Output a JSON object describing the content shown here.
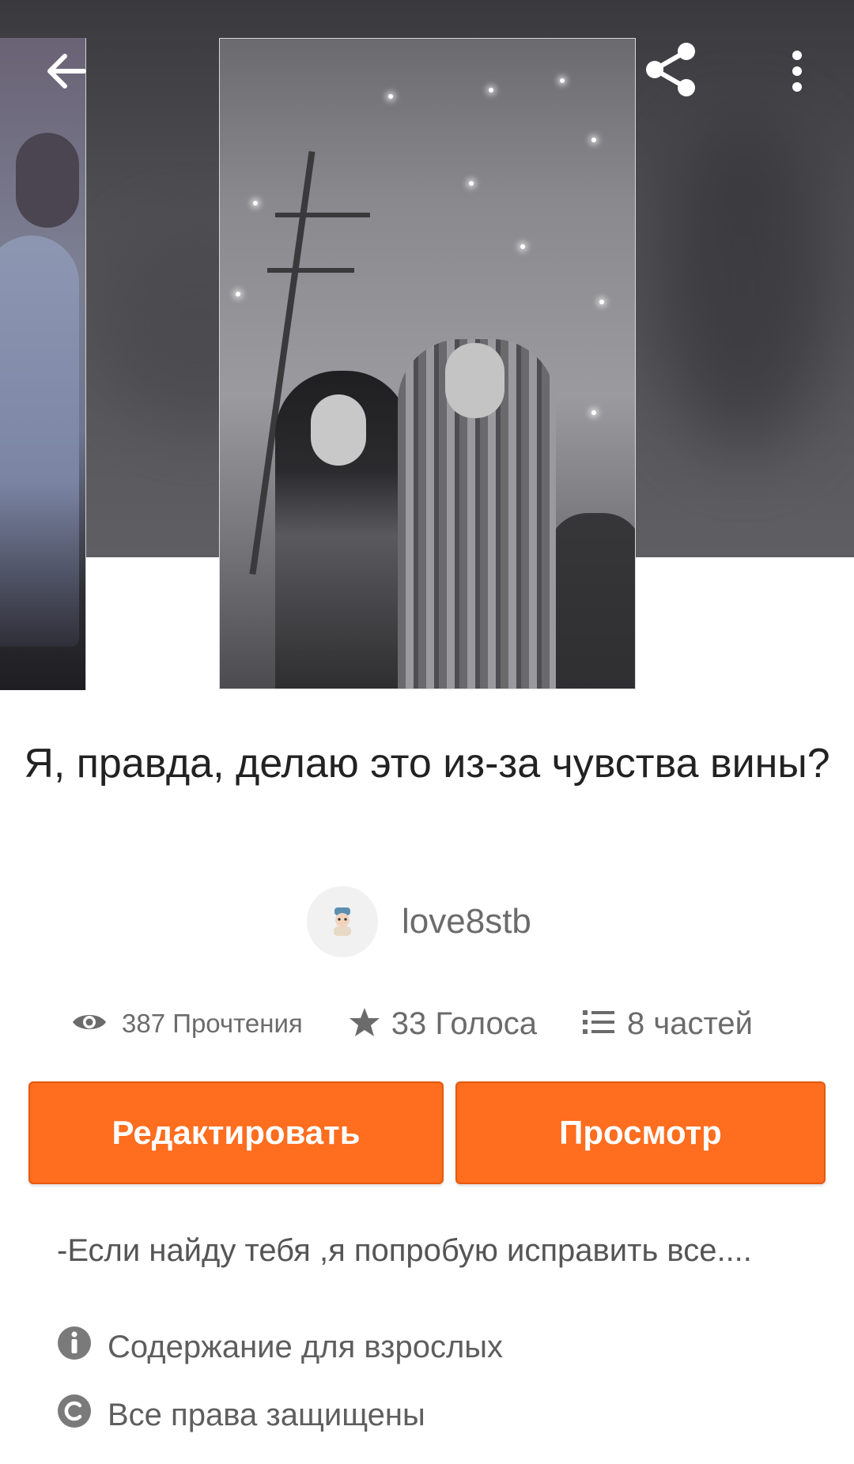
{
  "header": {
    "back_icon": "arrow-left-icon",
    "share_icon": "share-icon",
    "more_icon": "more-vertical-icon"
  },
  "story": {
    "title": "Я, правда, делаю это из-за чувства вины?",
    "author": "love8stb",
    "stats": {
      "reads": "387 Прочтения",
      "votes": "33 Голоса",
      "parts": "8 частей"
    },
    "description": "-Если найду тебя ,я попробую исправить все....",
    "mature_label": "Содержание для взрослых",
    "copyright_label": "Все права защищены"
  },
  "actions": {
    "edit_label": "Редактировать",
    "view_label": "Просмотр"
  },
  "colors": {
    "accent": "#ff6d1f",
    "text_primary": "#222222",
    "text_secondary": "#6b6b6b"
  }
}
